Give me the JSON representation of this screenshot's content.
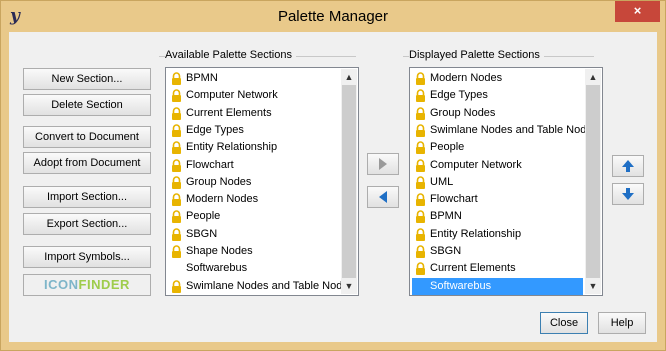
{
  "window": {
    "title": "Palette Manager",
    "close_glyph": "×"
  },
  "buttons": {
    "new_section": "New Section...",
    "delete_section": "Delete Section",
    "convert_to_document": "Convert to Document",
    "adopt_from_document": "Adopt from Document",
    "import_section": "Import Section...",
    "export_section": "Export Section...",
    "import_symbols": "Import Symbols...",
    "close": "Close",
    "help": "Help"
  },
  "logo": {
    "text_a": "ICON",
    "text_b": "FINDER"
  },
  "available": {
    "label": "Available Palette Sections",
    "items": [
      {
        "label": "BPMN",
        "locked": true
      },
      {
        "label": "Computer Network",
        "locked": true
      },
      {
        "label": "Current Elements",
        "locked": true
      },
      {
        "label": "Edge Types",
        "locked": true
      },
      {
        "label": "Entity Relationship",
        "locked": true
      },
      {
        "label": "Flowchart",
        "locked": true
      },
      {
        "label": "Group Nodes",
        "locked": true
      },
      {
        "label": "Modern Nodes",
        "locked": true
      },
      {
        "label": "People",
        "locked": true
      },
      {
        "label": "SBGN",
        "locked": true
      },
      {
        "label": "Shape Nodes",
        "locked": true
      },
      {
        "label": "Softwarebus",
        "locked": false
      },
      {
        "label": "Swimlane Nodes and Table Nodes",
        "locked": true
      }
    ]
  },
  "displayed": {
    "label": "Displayed Palette Sections",
    "items": [
      {
        "label": "Modern Nodes",
        "locked": true
      },
      {
        "label": "Edge Types",
        "locked": true
      },
      {
        "label": "Group Nodes",
        "locked": true
      },
      {
        "label": "Swimlane Nodes and Table Nodes",
        "locked": true
      },
      {
        "label": "People",
        "locked": true
      },
      {
        "label": "Computer Network",
        "locked": true
      },
      {
        "label": "UML",
        "locked": true
      },
      {
        "label": "Flowchart",
        "locked": true
      },
      {
        "label": "BPMN",
        "locked": true
      },
      {
        "label": "Entity Relationship",
        "locked": true
      },
      {
        "label": "SBGN",
        "locked": true
      },
      {
        "label": "Current Elements",
        "locked": true
      },
      {
        "label": "Softwarebus",
        "locked": false,
        "selected": true
      }
    ]
  },
  "colors": {
    "selection": "#3399ff",
    "lock": "#e8b400",
    "arrow_blue": "#1f6fc5",
    "arrow_gray": "#9a9a9a"
  }
}
